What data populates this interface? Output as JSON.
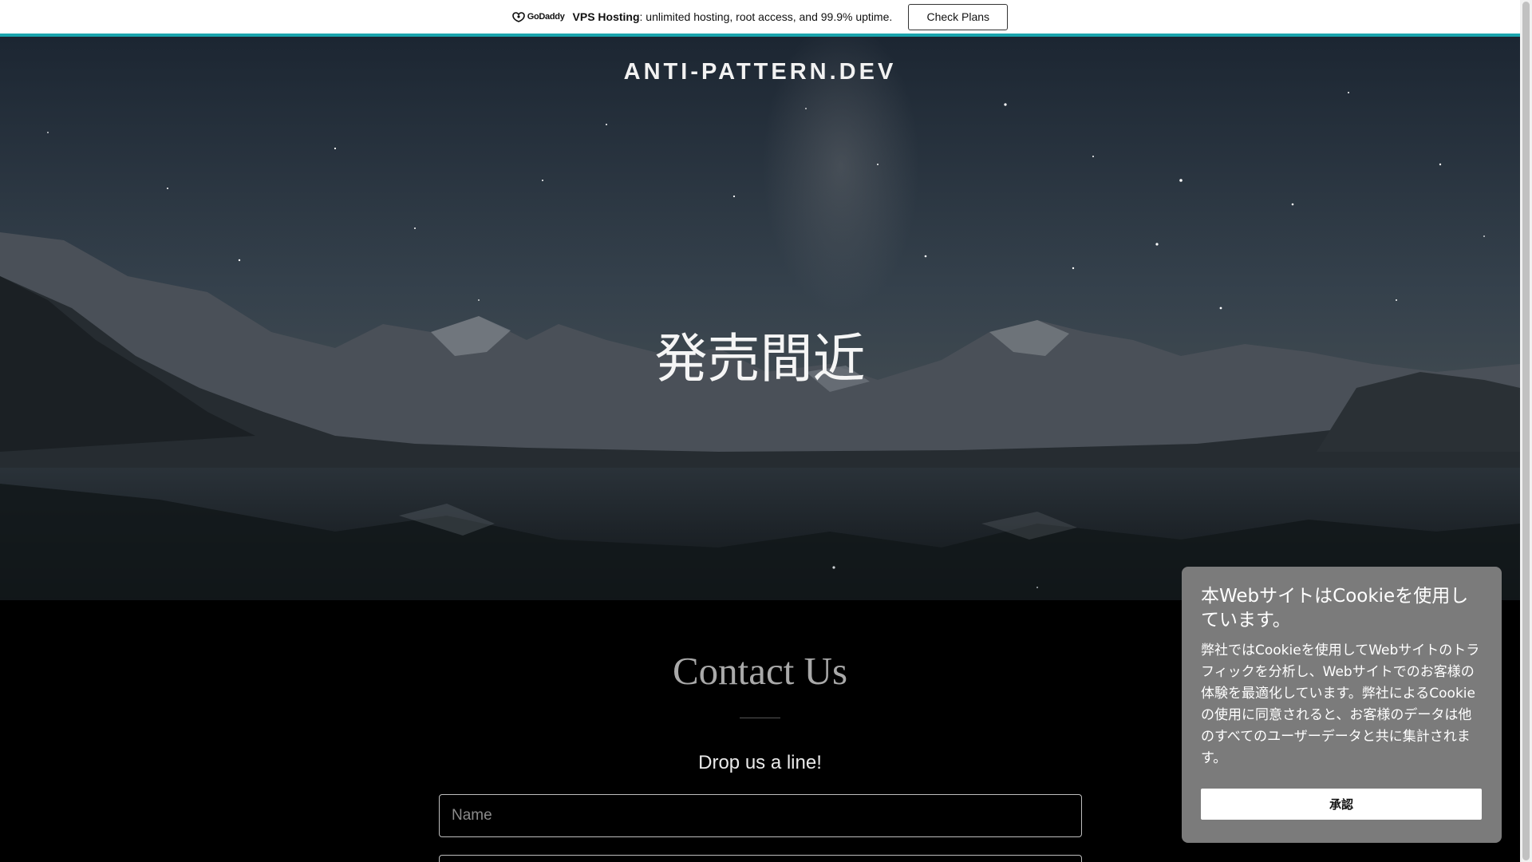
{
  "promo": {
    "brand": "GoDaddy",
    "product": "VPS Hosting",
    "message": ": unlimited hosting, root access, and 99.9% uptime.",
    "cta_label": "Check Plans"
  },
  "hero": {
    "site_title": "ANTI-PATTERN.DEV",
    "heading": "発売間近"
  },
  "contact": {
    "title": "Contact Us",
    "subtitle": "Drop us a line!",
    "name_placeholder": "Name"
  },
  "cookie": {
    "title": "本WebサイトはCookieを使用しています。",
    "body": "弊社ではCookieを使用してWebサイトのトラフィックを分析し、Webサイトでのお客様の体験を最適化しています。弊社によるCookieの使用に同意されると、お客様のデータは他のすべてのユーザーデータと共に集計されます。",
    "accept_label": "承認"
  },
  "colors": {
    "accent": "#1aa4ad",
    "cookie_bg": "#7b7b7b"
  }
}
